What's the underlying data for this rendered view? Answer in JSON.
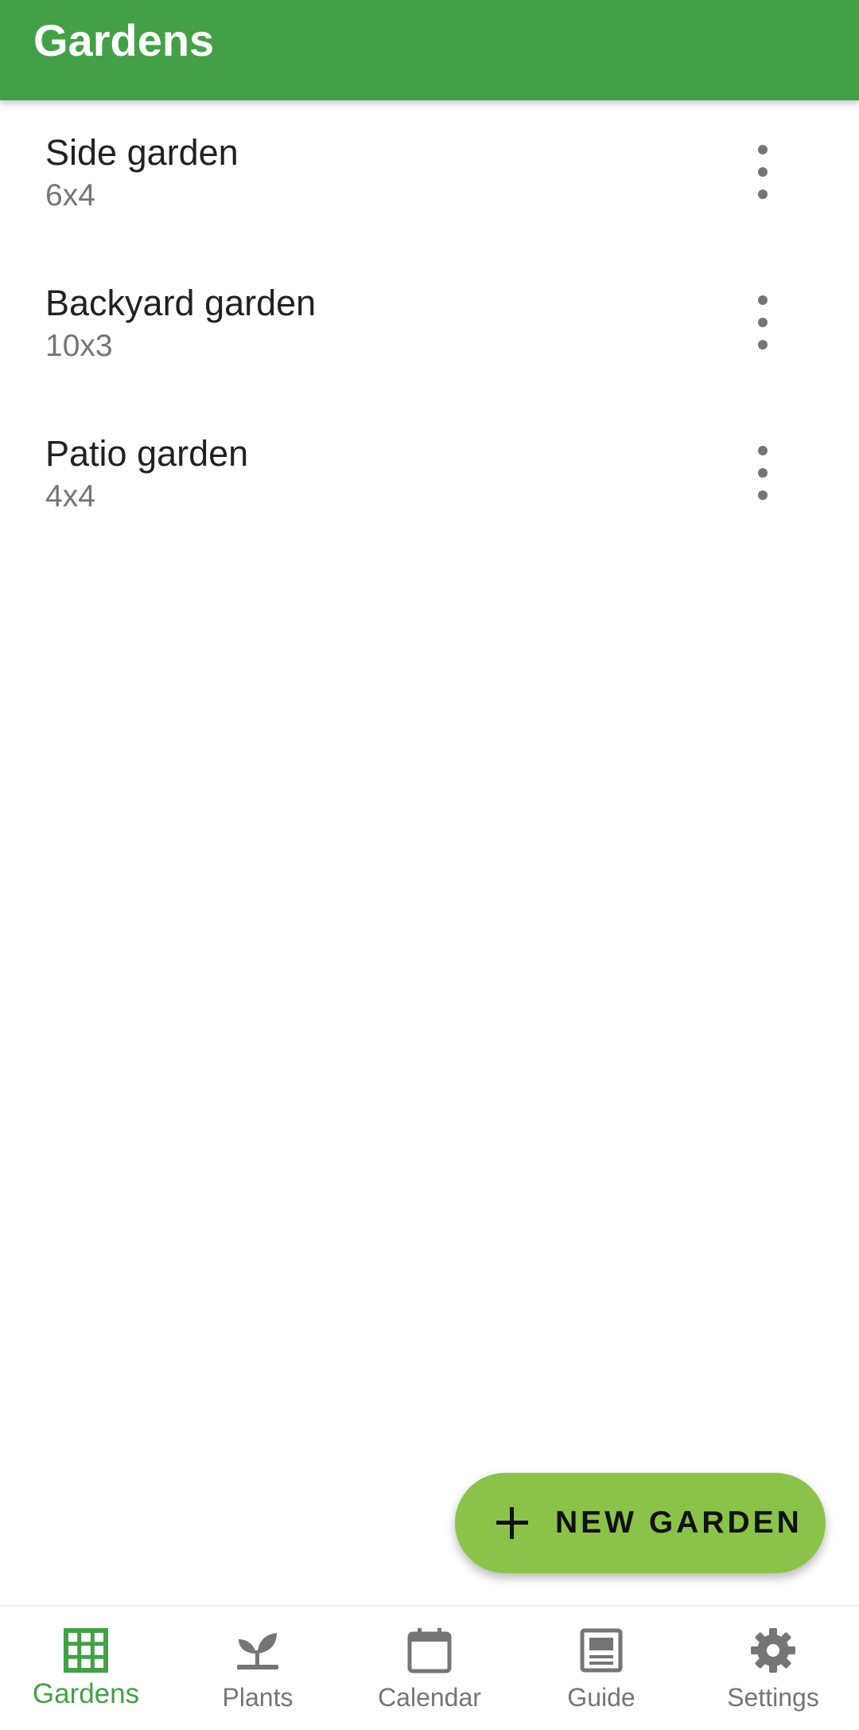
{
  "app_bar": {
    "title": "Gardens",
    "color": "#43a047"
  },
  "gardens": [
    {
      "name": "Side garden",
      "size": "6x4",
      "menu_icon": "more-vert-icon"
    },
    {
      "name": "Backyard garden",
      "size": "10x3",
      "menu_icon": "more-vert-icon"
    },
    {
      "name": "Patio garden",
      "size": "4x4",
      "menu_icon": "more-vert-icon"
    }
  ],
  "fab": {
    "label": "NEW GARDEN",
    "icon": "plus-icon",
    "color": "#8bc34a"
  },
  "bottom_nav": {
    "items": [
      {
        "label": "Gardens",
        "icon": "grid-icon",
        "active": true
      },
      {
        "label": "Plants",
        "icon": "sprout-icon",
        "active": false
      },
      {
        "label": "Calendar",
        "icon": "calendar-icon",
        "active": false
      },
      {
        "label": "Guide",
        "icon": "guide-icon",
        "active": false
      },
      {
        "label": "Settings",
        "icon": "gear-icon",
        "active": false
      }
    ],
    "active_color": "#43a047",
    "inactive_color": "#757575"
  }
}
